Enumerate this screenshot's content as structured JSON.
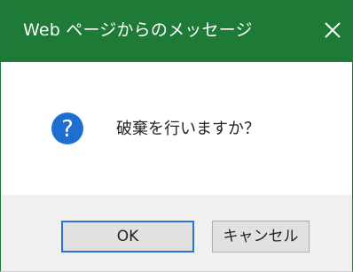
{
  "dialog": {
    "title": "Web ページからのメッセージ",
    "close_glyph": "close-icon",
    "message": "破棄を行いますか？",
    "icon": "question-icon",
    "buttons": {
      "ok_label": "OK",
      "cancel_label": "キャンセル"
    }
  },
  "colors": {
    "titlebar": "#1d7a37",
    "question_icon": "#1f6fd1",
    "ok_focus_border": "#2a73d8",
    "footer_bg": "#f0f0f0"
  }
}
